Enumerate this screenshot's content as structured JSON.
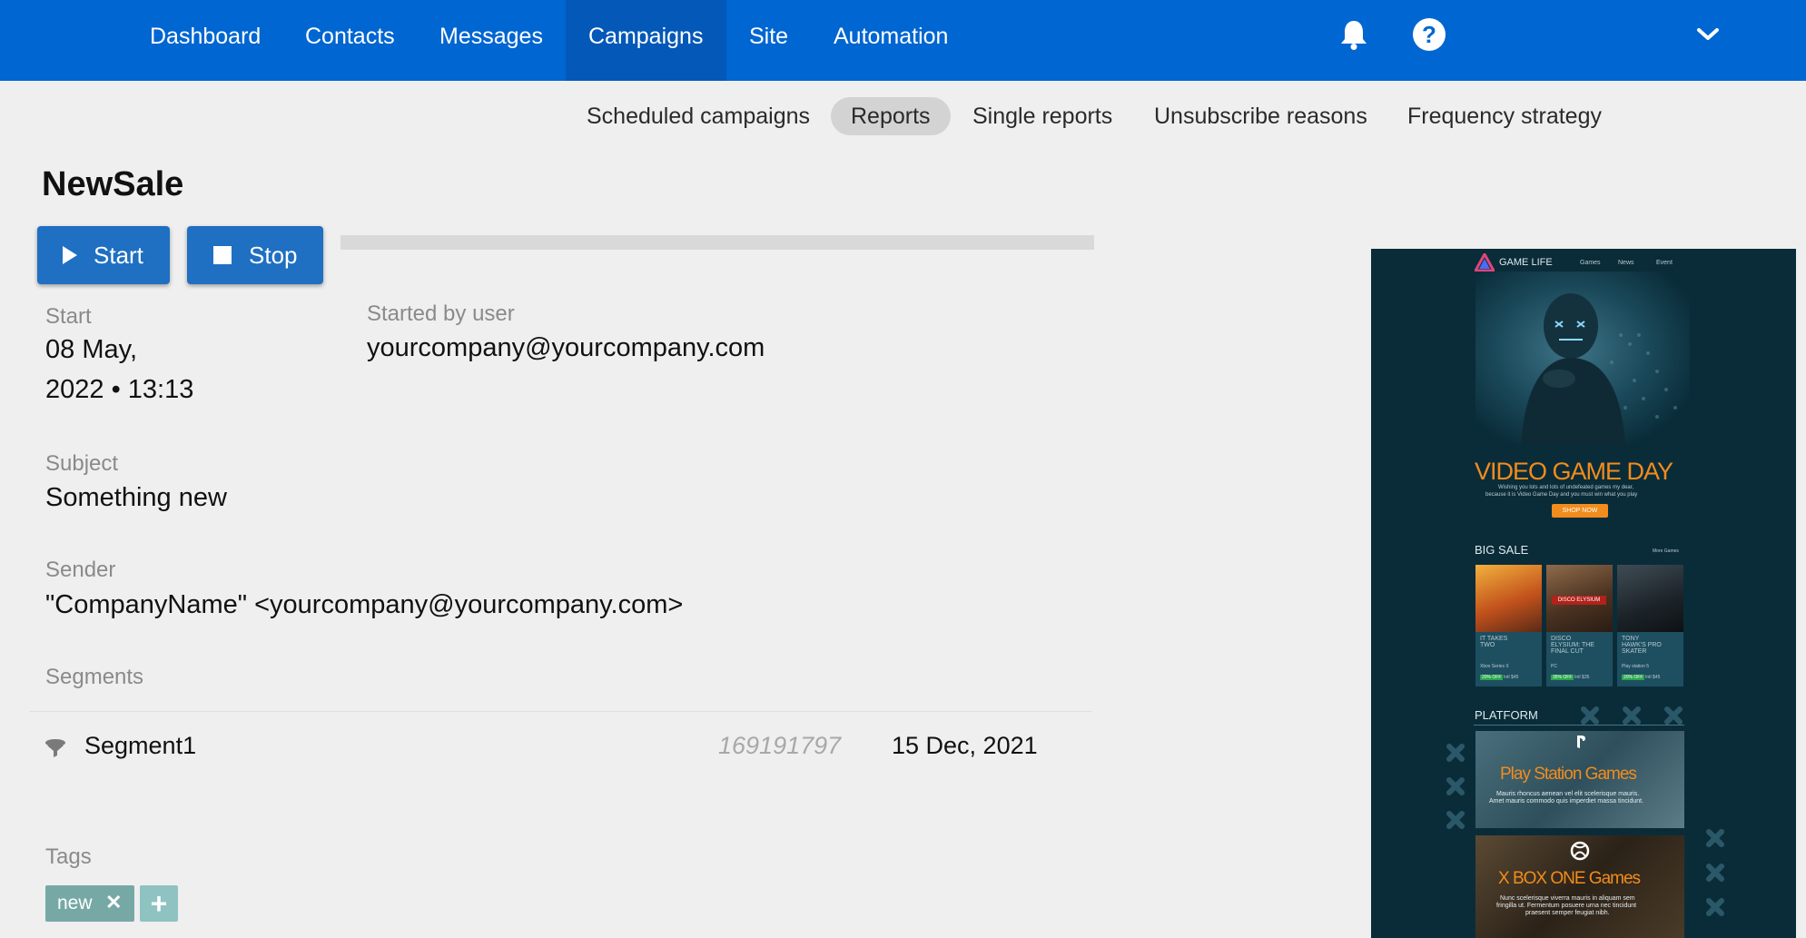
{
  "nav": {
    "items": [
      {
        "label": "Dashboard"
      },
      {
        "label": "Contacts"
      },
      {
        "label": "Messages"
      },
      {
        "label": "Campaigns",
        "active": true
      },
      {
        "label": "Site"
      },
      {
        "label": "Automation"
      }
    ],
    "help_glyph": "?"
  },
  "subnav": {
    "items": [
      {
        "label": "Scheduled campaigns"
      },
      {
        "label": "Reports",
        "active": true
      },
      {
        "label": "Single reports"
      },
      {
        "label": "Unsubscribe reasons"
      },
      {
        "label": "Frequency strategy"
      }
    ]
  },
  "campaign": {
    "title": "NewSale",
    "start_button": "Start",
    "stop_button": "Stop",
    "start_label": "Start",
    "start_date": "08 May,",
    "start_time": "2022 • 13:13",
    "started_by_label": "Started by user",
    "started_by": "yourcompany@yourcompany.com",
    "subject_label": "Subject",
    "subject": "Something new",
    "sender_label": "Sender",
    "sender": "\"CompanyName\" <yourcompany@yourcompany.com>",
    "segments_label": "Segments",
    "segments": [
      {
        "name": "Segment1",
        "id": "169191797",
        "date": "15 Dec, 2021"
      }
    ],
    "tags_label": "Tags",
    "tags": [
      {
        "label": "new",
        "remove_glyph": "✕"
      }
    ],
    "add_tag_glyph": "+"
  },
  "preview": {
    "brand": "GAME LIFE",
    "menu": [
      "Games",
      "News",
      "Event"
    ],
    "hero_title": "VIDEO GAME DAY",
    "hero_text_1": "Wishing you lots and lots of undefeated games my dear,",
    "hero_text_2": "because it is Video Game Day and you must win what you play",
    "hero_button": "SHOP NOW",
    "sale_title": "BIG SALE",
    "sale_link": "More Games",
    "products": [
      {
        "name_1": "IT TAKES",
        "name_2": "TWO",
        "name_3": "",
        "platform": "Xbox Series X",
        "discount": "20% OFF",
        "price": "Intl $45"
      },
      {
        "name_1": "DISCO",
        "name_2": "ELYSIUM: THE",
        "name_3": "FINAL CUT",
        "platform": "PC",
        "discount": "35% OFF",
        "price": "Intl $35",
        "cover": "DISCO ELYSIUM"
      },
      {
        "name_1": "TONY",
        "name_2": "HAWK'S PRO",
        "name_3": "SKATER",
        "platform": "Play station 5",
        "discount": "20% OFF",
        "price": "Intl $45"
      }
    ],
    "platform_title": "PLATFORM",
    "ps_title": "Play Station Games",
    "ps_text_1": "Mauris rhoncus aenean vel elit scelerisque mauris.",
    "ps_text_2": "Amet mauris commodo quis imperdiet massa tincidunt.",
    "xbox_title": "X BOX ONE Games",
    "xbox_text_1": "Nunc scelerisque viverra mauris in aliquam sem",
    "xbox_text_2": "fringilla ut. Fermentum posuere urna nec tincidunt",
    "xbox_text_3": "praesent semper feugiat nibh.",
    "colors": {
      "background": "#0a2c39",
      "accent": "#f28c1c"
    }
  },
  "colors": {
    "nav_bg": "#0066d1",
    "nav_active_bg": "#0358b8",
    "button_bg": "#1f6fc2",
    "page_bg": "#efefef",
    "tag_bg": "#76a9a6"
  }
}
